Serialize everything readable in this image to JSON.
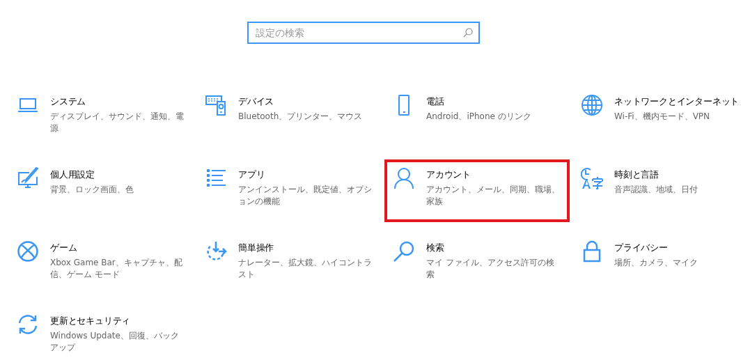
{
  "search": {
    "placeholder": "設定の検索"
  },
  "items": [
    {
      "title": "システム",
      "description": "ディスプレイ、サウンド、通知、電源",
      "highlighted": false
    },
    {
      "title": "デバイス",
      "description": "Bluetooth、プリンター、マウス",
      "highlighted": false
    },
    {
      "title": "電話",
      "description": "Android、iPhone のリンク",
      "highlighted": false
    },
    {
      "title": "ネットワークとインターネット",
      "description": "Wi-Fi、機内モード、VPN",
      "highlighted": false
    },
    {
      "title": "個人用設定",
      "description": "背景、ロック画面、色",
      "highlighted": false
    },
    {
      "title": "アプリ",
      "description": "アンインストール、既定値、オプションの機能",
      "highlighted": false
    },
    {
      "title": "アカウント",
      "description": "アカウント、メール、同期、職場、家族",
      "highlighted": true
    },
    {
      "title": "時刻と言語",
      "description": "音声認識、地域、日付",
      "highlighted": false
    },
    {
      "title": "ゲーム",
      "description": "Xbox Game Bar、キャプチャ、配信、ゲーム モード",
      "highlighted": false
    },
    {
      "title": "簡単操作",
      "description": "ナレーター、拡大鏡、ハイコントラスト",
      "highlighted": false
    },
    {
      "title": "検索",
      "description": "マイ ファイル、アクセス許可の検索",
      "highlighted": false
    },
    {
      "title": "プライバシー",
      "description": "場所、カメラ、マイク",
      "highlighted": false
    },
    {
      "title": "更新とセキュリティ",
      "description": "Windows Update、回復、バックアップ",
      "highlighted": false
    }
  ]
}
